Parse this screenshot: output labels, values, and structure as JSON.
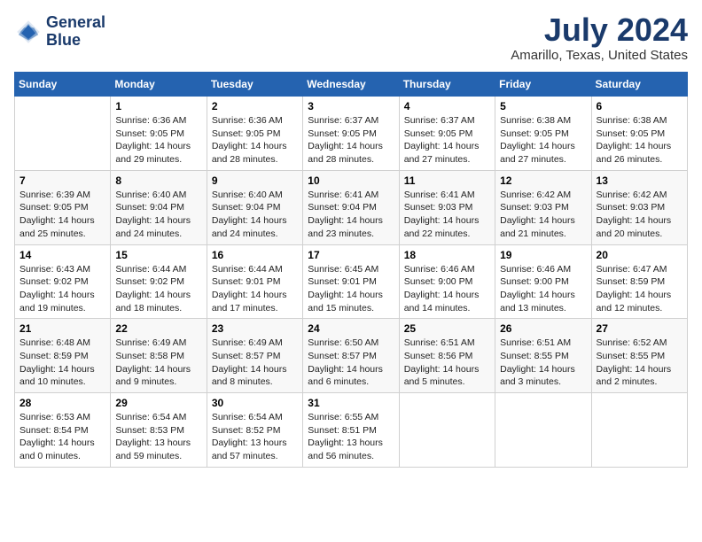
{
  "header": {
    "logo_line1": "General",
    "logo_line2": "Blue",
    "month": "July 2024",
    "location": "Amarillo, Texas, United States"
  },
  "days_of_week": [
    "Sunday",
    "Monday",
    "Tuesday",
    "Wednesday",
    "Thursday",
    "Friday",
    "Saturday"
  ],
  "weeks": [
    [
      {
        "day": "",
        "content": ""
      },
      {
        "day": "1",
        "content": "Sunrise: 6:36 AM\nSunset: 9:05 PM\nDaylight: 14 hours\nand 29 minutes."
      },
      {
        "day": "2",
        "content": "Sunrise: 6:36 AM\nSunset: 9:05 PM\nDaylight: 14 hours\nand 28 minutes."
      },
      {
        "day": "3",
        "content": "Sunrise: 6:37 AM\nSunset: 9:05 PM\nDaylight: 14 hours\nand 28 minutes."
      },
      {
        "day": "4",
        "content": "Sunrise: 6:37 AM\nSunset: 9:05 PM\nDaylight: 14 hours\nand 27 minutes."
      },
      {
        "day": "5",
        "content": "Sunrise: 6:38 AM\nSunset: 9:05 PM\nDaylight: 14 hours\nand 27 minutes."
      },
      {
        "day": "6",
        "content": "Sunrise: 6:38 AM\nSunset: 9:05 PM\nDaylight: 14 hours\nand 26 minutes."
      }
    ],
    [
      {
        "day": "7",
        "content": "Sunrise: 6:39 AM\nSunset: 9:05 PM\nDaylight: 14 hours\nand 25 minutes."
      },
      {
        "day": "8",
        "content": "Sunrise: 6:40 AM\nSunset: 9:04 PM\nDaylight: 14 hours\nand 24 minutes."
      },
      {
        "day": "9",
        "content": "Sunrise: 6:40 AM\nSunset: 9:04 PM\nDaylight: 14 hours\nand 24 minutes."
      },
      {
        "day": "10",
        "content": "Sunrise: 6:41 AM\nSunset: 9:04 PM\nDaylight: 14 hours\nand 23 minutes."
      },
      {
        "day": "11",
        "content": "Sunrise: 6:41 AM\nSunset: 9:03 PM\nDaylight: 14 hours\nand 22 minutes."
      },
      {
        "day": "12",
        "content": "Sunrise: 6:42 AM\nSunset: 9:03 PM\nDaylight: 14 hours\nand 21 minutes."
      },
      {
        "day": "13",
        "content": "Sunrise: 6:42 AM\nSunset: 9:03 PM\nDaylight: 14 hours\nand 20 minutes."
      }
    ],
    [
      {
        "day": "14",
        "content": "Sunrise: 6:43 AM\nSunset: 9:02 PM\nDaylight: 14 hours\nand 19 minutes."
      },
      {
        "day": "15",
        "content": "Sunrise: 6:44 AM\nSunset: 9:02 PM\nDaylight: 14 hours\nand 18 minutes."
      },
      {
        "day": "16",
        "content": "Sunrise: 6:44 AM\nSunset: 9:01 PM\nDaylight: 14 hours\nand 17 minutes."
      },
      {
        "day": "17",
        "content": "Sunrise: 6:45 AM\nSunset: 9:01 PM\nDaylight: 14 hours\nand 15 minutes."
      },
      {
        "day": "18",
        "content": "Sunrise: 6:46 AM\nSunset: 9:00 PM\nDaylight: 14 hours\nand 14 minutes."
      },
      {
        "day": "19",
        "content": "Sunrise: 6:46 AM\nSunset: 9:00 PM\nDaylight: 14 hours\nand 13 minutes."
      },
      {
        "day": "20",
        "content": "Sunrise: 6:47 AM\nSunset: 8:59 PM\nDaylight: 14 hours\nand 12 minutes."
      }
    ],
    [
      {
        "day": "21",
        "content": "Sunrise: 6:48 AM\nSunset: 8:59 PM\nDaylight: 14 hours\nand 10 minutes."
      },
      {
        "day": "22",
        "content": "Sunrise: 6:49 AM\nSunset: 8:58 PM\nDaylight: 14 hours\nand 9 minutes."
      },
      {
        "day": "23",
        "content": "Sunrise: 6:49 AM\nSunset: 8:57 PM\nDaylight: 14 hours\nand 8 minutes."
      },
      {
        "day": "24",
        "content": "Sunrise: 6:50 AM\nSunset: 8:57 PM\nDaylight: 14 hours\nand 6 minutes."
      },
      {
        "day": "25",
        "content": "Sunrise: 6:51 AM\nSunset: 8:56 PM\nDaylight: 14 hours\nand 5 minutes."
      },
      {
        "day": "26",
        "content": "Sunrise: 6:51 AM\nSunset: 8:55 PM\nDaylight: 14 hours\nand 3 minutes."
      },
      {
        "day": "27",
        "content": "Sunrise: 6:52 AM\nSunset: 8:55 PM\nDaylight: 14 hours\nand 2 minutes."
      }
    ],
    [
      {
        "day": "28",
        "content": "Sunrise: 6:53 AM\nSunset: 8:54 PM\nDaylight: 14 hours\nand 0 minutes."
      },
      {
        "day": "29",
        "content": "Sunrise: 6:54 AM\nSunset: 8:53 PM\nDaylight: 13 hours\nand 59 minutes."
      },
      {
        "day": "30",
        "content": "Sunrise: 6:54 AM\nSunset: 8:52 PM\nDaylight: 13 hours\nand 57 minutes."
      },
      {
        "day": "31",
        "content": "Sunrise: 6:55 AM\nSunset: 8:51 PM\nDaylight: 13 hours\nand 56 minutes."
      },
      {
        "day": "",
        "content": ""
      },
      {
        "day": "",
        "content": ""
      },
      {
        "day": "",
        "content": ""
      }
    ]
  ]
}
